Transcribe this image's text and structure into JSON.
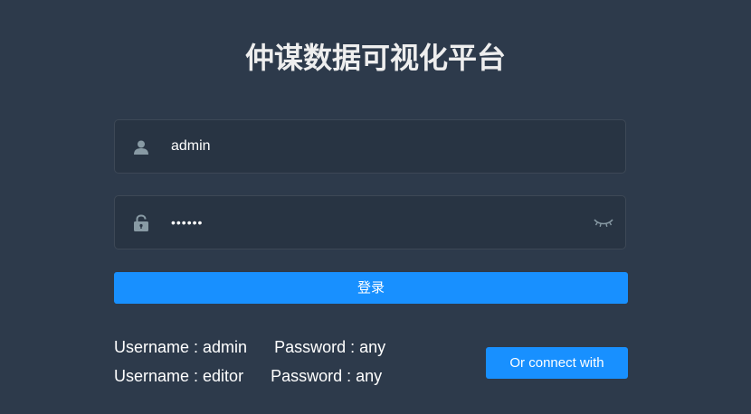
{
  "title": "仲谋数据可视化平台",
  "form": {
    "username": {
      "value": "admin",
      "icon": "user-icon"
    },
    "password": {
      "value": "••••••",
      "icon": "lock-icon",
      "toggle_icon": "eye-closed-icon"
    },
    "login_label": "登录"
  },
  "tips": [
    {
      "username": "Username : admin",
      "password": "Password : any"
    },
    {
      "username": "Username : editor",
      "password": "Password : any"
    }
  ],
  "connect_label": "Or connect with",
  "colors": {
    "background": "#2d3a4b",
    "field_background": "#283443",
    "primary": "#1890ff",
    "icon": "#889aa4"
  }
}
